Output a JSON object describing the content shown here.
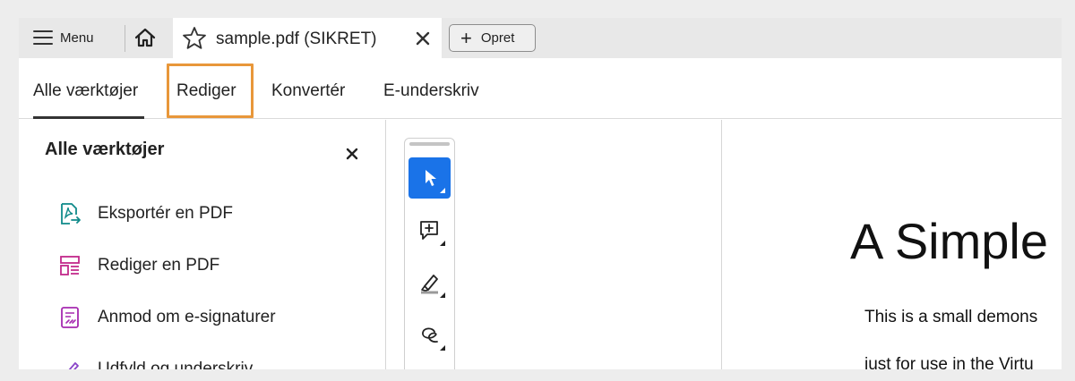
{
  "tabbar": {
    "menu_label": "Menu",
    "document_tab_title": "sample.pdf (SIKRET)",
    "new_button_label": "Opret",
    "icons": {
      "menu": "hamburger-icon",
      "home": "home-icon",
      "favorite": "star-icon",
      "close": "close-icon",
      "new": "plus-icon"
    }
  },
  "toolnav": {
    "tabs": [
      {
        "label": "Alle værktøjer",
        "active": true
      },
      {
        "label": "Rediger",
        "highlighted": true
      },
      {
        "label": "Konvertér"
      },
      {
        "label": "E-underskriv"
      }
    ],
    "highlight_color": "#e8973a"
  },
  "leftpanel": {
    "title": "Alle værktøjer",
    "items": [
      {
        "label": "Eksportér en PDF",
        "icon": "export-pdf-icon",
        "color": "#0f8a8a"
      },
      {
        "label": "Rediger en PDF",
        "icon": "edit-pdf-icon",
        "color": "#c2288a"
      },
      {
        "label": "Anmod om e-signaturer",
        "icon": "request-esign-icon",
        "color": "#a62ab0"
      },
      {
        "label": "Udfyld og underskriv",
        "icon": "fill-sign-icon",
        "color": "#8a45c9"
      }
    ]
  },
  "quickbar": {
    "tools": [
      {
        "name": "select",
        "icon": "cursor-icon",
        "active": true
      },
      {
        "name": "comment",
        "icon": "add-comment-icon"
      },
      {
        "name": "highlight",
        "icon": "highlighter-icon"
      },
      {
        "name": "draw",
        "icon": "freehand-draw-icon"
      }
    ],
    "active_color": "#1a73e8"
  },
  "document": {
    "heading": "A Simple",
    "lines": [
      "This is a small demons",
      "just for use in the Virtu"
    ]
  }
}
